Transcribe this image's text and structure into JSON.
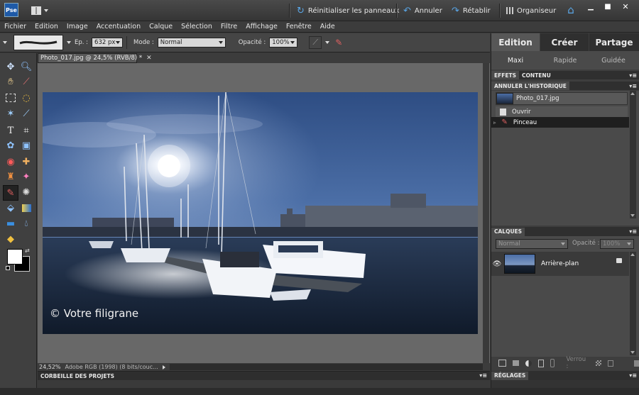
{
  "titlebar": {
    "app_logo": "Pse",
    "reset_panels": "Réinitialiser les panneaux",
    "undo": "Annuler",
    "redo": "Rétablir",
    "organizer": "Organiseur"
  },
  "menu": [
    "Fichier",
    "Edition",
    "Image",
    "Accentuation",
    "Calque",
    "Sélection",
    "Filtre",
    "Affichage",
    "Fenêtre",
    "Aide"
  ],
  "options": {
    "size_label": "Ep. :",
    "size_value": "632 px",
    "mode_label": "Mode :",
    "mode_value": "Normal",
    "opacity_label": "Opacité :",
    "opacity_value": "100%"
  },
  "document": {
    "tab_title": "Photo_017.jpg @ 24,5% (RVB/8) *",
    "watermark": "© Votre filigrane",
    "zoom": "24,52%",
    "profile": "Adobe RGB (1998) (8 bits/couc..."
  },
  "project_bin": "CORBEILLE DES PROJETS",
  "panel": {
    "mode_tabs": [
      "Edition",
      "Créer",
      "Partage"
    ],
    "sub_tabs": [
      "Maxi",
      "Rapide",
      "Guidée"
    ],
    "effects_tabs": [
      "EFFETS",
      "CONTENU"
    ],
    "history_title": "ANNULER L'HISTORIQUE",
    "history_items": [
      "Photo_017.jpg",
      "Ouvrir",
      "Pinceau"
    ],
    "layers_title": "CALQUES",
    "blend_mode": "Normal",
    "layer_opacity_label": "Opacité :",
    "layer_opacity_value": "100%",
    "layer_name": "Arrière-plan",
    "lock_label": "Verrou :",
    "adjustments_title": "RÉGLAGES"
  },
  "colors": {
    "accent_blue": "#1e5aa8",
    "selected_row": "#1f1f1f",
    "panel_bg": "#3e3e3e"
  }
}
